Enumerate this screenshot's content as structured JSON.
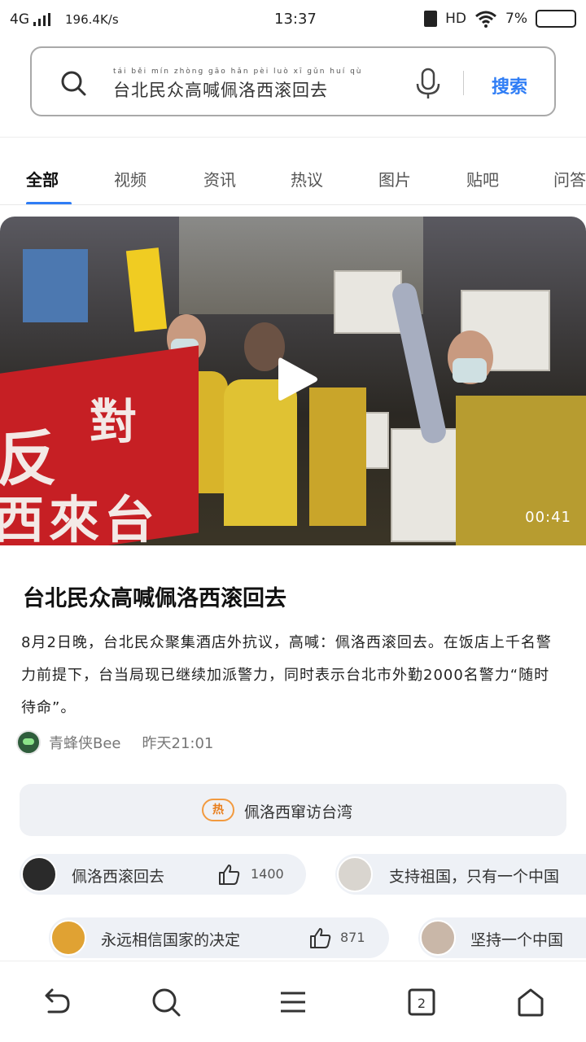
{
  "status_bar": {
    "network": "4G",
    "speed": "196.4K/s",
    "time": "13:37",
    "hd": "HD",
    "battery": "7%"
  },
  "search": {
    "pinyin": "tái běi mín zhòng gāo hǎn pèi luò xī gǔn huí qù",
    "query": "台北民众高喊佩洛西滚回去",
    "button_label": "搜索",
    "icon": "search-icon",
    "mic_icon": "mic-icon"
  },
  "tabs": [
    {
      "label": "全部",
      "active": true
    },
    {
      "label": "视频"
    },
    {
      "label": "资讯"
    },
    {
      "label": "热议"
    },
    {
      "label": "图片"
    },
    {
      "label": "贴吧"
    },
    {
      "label": "问答"
    }
  ],
  "video": {
    "duration": "00:41",
    "banner_text_1": "反",
    "banner_text_2": "對",
    "banner_text_3": "西來台"
  },
  "article": {
    "title": "台北民众高喊佩洛西滚回去",
    "body": "8月2日晚，台北民众聚集酒店外抗议，高喊：佩洛西滚回去。在饭店上千名警力前提下，台当局现已继续加派警力，同时表示台北市外勤2000名警力“随时待命”。",
    "author": "青蜂侠Bee",
    "time": "昨天21:01"
  },
  "hot_topic": {
    "badge": "热",
    "text": "佩洛西窜访台湾"
  },
  "related": [
    {
      "text": "佩洛西滚回去",
      "count": "1400"
    },
    {
      "text": "支持祖国，只有一个中国"
    },
    {
      "text": "永远相信国家的决定",
      "count": "871"
    },
    {
      "text": "坚持一个中国"
    }
  ],
  "colors": {
    "accent": "#2f7df5",
    "hot": "#f29a3f",
    "chip_bg": "#eef1f6"
  }
}
